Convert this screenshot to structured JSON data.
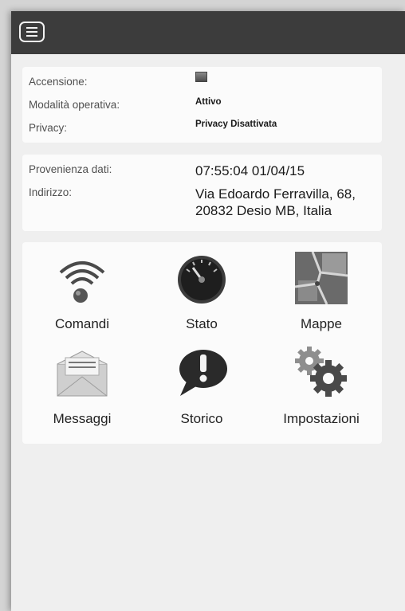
{
  "header": {
    "menu_icon": "hamburger-menu-icon"
  },
  "status": {
    "accensione_label": "Accensione:",
    "accensione_indicator": "square-indicator-icon",
    "modalita_label": "Modalità operativa:",
    "modalita_value": "Attivo",
    "privacy_label": "Privacy:",
    "privacy_value": "Privacy Disattivata"
  },
  "location": {
    "provenienza_label": "Provenienza dati:",
    "provenienza_value": "07:55:04 01/04/15",
    "indirizzo_label": "Indirizzo:",
    "indirizzo_line1": "Via Edoardo Ferravilla, 68,",
    "indirizzo_line2": "20832 Desio MB, Italia"
  },
  "grid": {
    "items": [
      {
        "label": "Comandi",
        "icon": "wifi-signal-icon"
      },
      {
        "label": "Stato",
        "icon": "speedometer-icon"
      },
      {
        "label": "Mappe",
        "icon": "map-icon"
      },
      {
        "label": "Messaggi",
        "icon": "envelope-icon"
      },
      {
        "label": "Storico",
        "icon": "exclamation-bubble-icon"
      },
      {
        "label": "Impostazioni",
        "icon": "gears-icon"
      }
    ]
  }
}
